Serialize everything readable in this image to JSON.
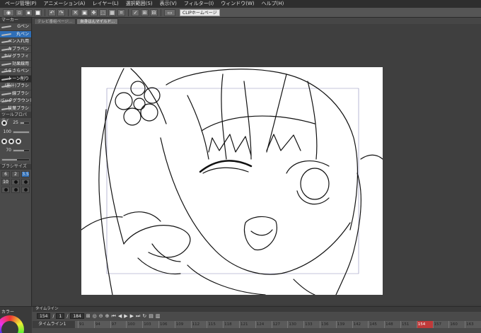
{
  "menu": {
    "items": [
      "ページ管理(P)",
      "アニメーション(A)",
      "レイヤー(L)",
      "選択範囲(S)",
      "表示(V)",
      "フィルター(I)",
      "ウィンドウ(W)",
      "ヘルプ(H)"
    ]
  },
  "toolbar": {
    "clip_home_label": "CLIPホームページ"
  },
  "tabs": [
    {
      "label": "テレビ番組ページ...",
      "active": false
    },
    {
      "label": "自身はんマイルド...",
      "active": true
    }
  ],
  "left_panel": {
    "subtool_header": "マーカー",
    "brushes": [
      "Gペン",
      "丸ペン",
      "ペン入れ用",
      "カブラペン",
      "カリグラフィ",
      "効果線用",
      "さらさらペン",
      "トーン削り",
      "(墨汁)ブラシ",
      "線ブラシ",
      "バックグラウンド 大",
      "枝葉ブラシ"
    ],
    "selected_brush_index": 1,
    "tool_property_header": "ツールプロパティ",
    "size_value": "25",
    "opacity_value": "100",
    "stabilization_value": "70",
    "brush_size_header": "ブラシサイズ",
    "brush_sizes": [
      "6",
      "2",
      "3.5",
      "10",
      "",
      "",
      "",
      "",
      ""
    ],
    "selected_size_index": 2
  },
  "timeline": {
    "header": "タイムライン",
    "current_frame": "154",
    "fps": "1",
    "end_frame": "184",
    "track_name": "タイムライン1",
    "frame_numbers": [
      "91",
      "94",
      "97",
      "100",
      "103",
      "106",
      "109",
      "112",
      "115",
      "118",
      "121",
      "124",
      "127",
      "130",
      "133",
      "136",
      "139",
      "142",
      "145",
      "148",
      "151",
      "154",
      "157",
      "160",
      "163"
    ],
    "highlight_frame": "154"
  },
  "color_panel": {
    "label": "カラー"
  },
  "colors": {
    "workspace_bg": "#3f3f3f",
    "panel_bg": "#4a4a4a",
    "selection_blue": "#2f6fb8",
    "playhead_red": "#c03a3a"
  }
}
